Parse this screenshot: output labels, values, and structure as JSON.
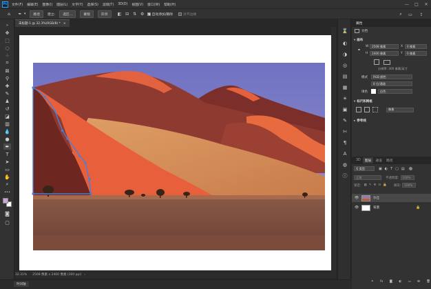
{
  "menubar": {
    "logo": "Ps",
    "items": [
      "文件(F)",
      "编辑(E)",
      "图像(I)",
      "图层(L)",
      "文字(Y)",
      "选择(S)",
      "滤镜(T)",
      "3D(D)",
      "视图(V)",
      "窗口(W)",
      "帮助(H)"
    ],
    "controls": [
      "—",
      "□",
      "✕"
    ]
  },
  "options": {
    "mode": "路径",
    "make_label": "建立:",
    "selection_btn": "选区...",
    "mask_btn": "蒙版",
    "shape_btn": "形状",
    "auto_add_delete": "自动添加/删除",
    "align_edges": "对齐边缘"
  },
  "document": {
    "tab_title": "未标题-1 @ 32.3%(RGB/8) *",
    "tab_close": "×"
  },
  "status": {
    "zoom": "32.31%",
    "info": "2508 像素 x 2400 像素 (300 ppi)"
  },
  "bottom": {
    "timeline": "时间轴"
  },
  "properties": {
    "tabs": [
      "属性"
    ],
    "doc_label": "文档",
    "canvas_title": "画布",
    "w_label": "W",
    "w_value": "2508 像素",
    "x_label": "X",
    "x_value": "0 像素",
    "h_label": "H",
    "h_value": "2400 像素",
    "y_label": "Y",
    "y_value": "0 像素",
    "resolution": "分辨率: 300 像素/英寸",
    "mode_label": "模式",
    "mode_value": "RGB 颜色",
    "bits_value": "8 位/通道",
    "bg_label": "填色",
    "bg_value": "白色",
    "rulers_title": "标尺和网格",
    "ruler_unit": "像素",
    "guides_title": "参考线"
  },
  "layers": {
    "tabs": [
      "3D",
      "图层",
      "通道",
      "路径"
    ],
    "filter_value": "Q 类型",
    "blend_mode": "正常",
    "opacity_label": "不透明度:",
    "opacity_value": "100%",
    "lock_label": "锁定:",
    "fill_label": "填充:",
    "fill_value": "100%",
    "items": [
      {
        "name": "沙丘",
        "kind": "photo"
      },
      {
        "name": "背景",
        "kind": "white",
        "locked": true
      }
    ]
  },
  "colors": {
    "accent": "#2fa3f6",
    "path": "#4a7fd8",
    "sky": "#7f80c4",
    "dune_light": "#e8623d",
    "dune_shadow": "#7a2a24",
    "dune_tan": "#d48a55",
    "ground": "#865443"
  }
}
